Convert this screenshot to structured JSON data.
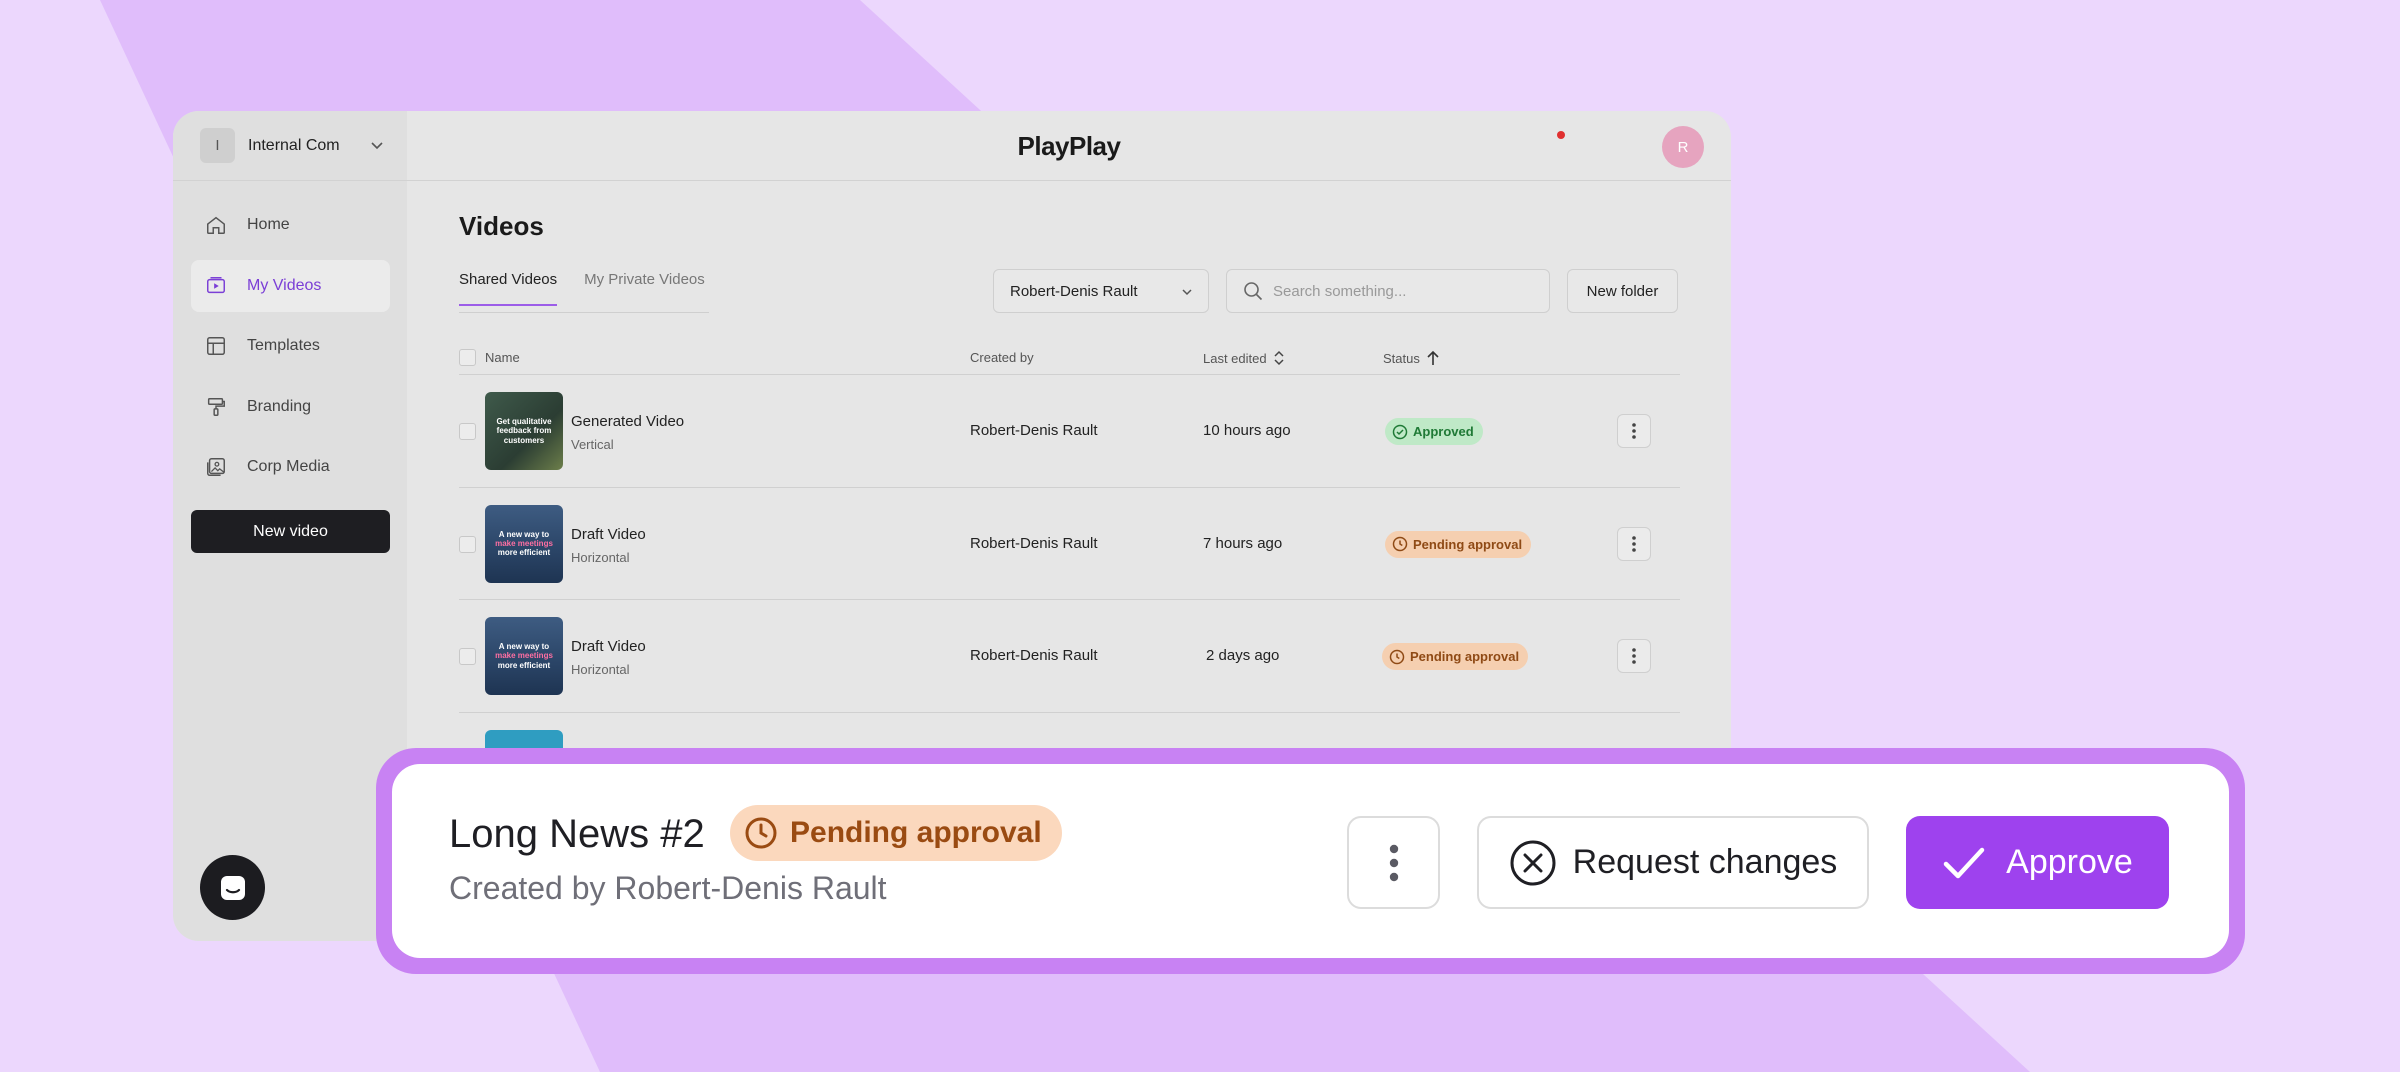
{
  "workspace": {
    "initial": "I",
    "name": "Internal Com"
  },
  "brand": {
    "logo": "PlayPlay"
  },
  "user": {
    "initial": "R"
  },
  "sidebar": {
    "items": [
      {
        "label": "Home",
        "icon": "home-icon",
        "active": false
      },
      {
        "label": "My Videos",
        "icon": "video-icon",
        "active": true
      },
      {
        "label": "Templates",
        "icon": "templates-icon",
        "active": false
      },
      {
        "label": "Branding",
        "icon": "paint-roller-icon",
        "active": false
      },
      {
        "label": "Corp Media",
        "icon": "media-icon",
        "active": false
      }
    ],
    "new_video": "New video"
  },
  "main": {
    "title": "Videos",
    "tabs": [
      "Shared Videos",
      "My Private Videos"
    ],
    "owner_filter": "Robert-Denis Rault",
    "search_placeholder": "Search something...",
    "new_folder": "New folder"
  },
  "table": {
    "headers": {
      "name": "Name",
      "created_by": "Created by",
      "last_edited": "Last edited",
      "status": "Status"
    },
    "rows": [
      {
        "name": "Generated Video",
        "format": "Vertical",
        "thumb_text": "Get qualitative feedback from customers",
        "created_by": "Robert-Denis Rault",
        "last_edited": "10 hours ago",
        "status": "Approved"
      },
      {
        "name": "Draft Video",
        "format": "Horizontal",
        "thumb_text_1": "A new way to",
        "thumb_text_2": "make meetings",
        "thumb_text_3": "more efficient",
        "created_by": "Robert-Denis Rault",
        "last_edited": "7 hours ago",
        "status": "Pending approval"
      },
      {
        "name": "Draft Video",
        "format": "Horizontal",
        "thumb_text_1": "A new way to",
        "thumb_text_2": "make meetings",
        "thumb_text_3": "more efficient",
        "created_by": "Robert-Denis Rault",
        "last_edited": "2 days ago",
        "status": "Pending approval"
      }
    ]
  },
  "approval": {
    "title": "Long News #2",
    "status": "Pending approval",
    "subtitle": "Created by Robert-Denis Rault",
    "request_changes": "Request changes",
    "approve": "Approve"
  },
  "colors": {
    "background": "#ecd7fd",
    "accent": "#9e42ee",
    "approved_bg": "#bfe9c7",
    "pending_bg": "#f5cfb0"
  }
}
